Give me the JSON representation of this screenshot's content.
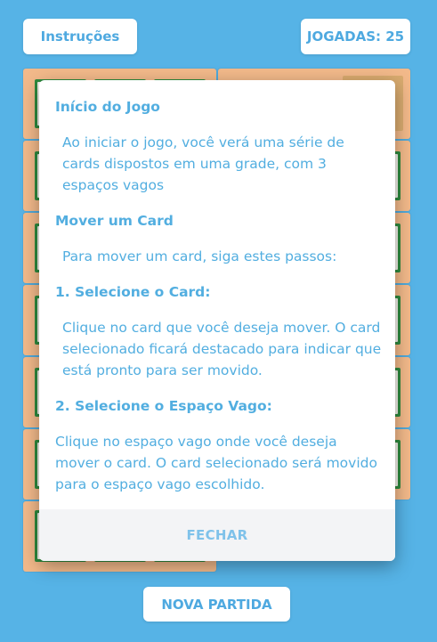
{
  "header": {
    "instructions_label": "Instruções",
    "moves_label": "JOGADAS: 25"
  },
  "modal": {
    "section1_title": "Início do Jogo",
    "section1_text": "Ao iniciar o jogo, você verá uma série de cards dispostos em uma grade, com 3 espaços vagos",
    "section2_title": "Mover um Card",
    "section2_text": "Para mover um card, siga estes passos:",
    "step1_title": "1. Selecione o Card:",
    "step1_text": "Clique no card que você deseja mover. O card selecionado ficará destacado para indicar que está pronto para ser movido.",
    "step2_title": "2. Selecione o Espaço Vago:",
    "step2_text": "Clique no espaço vago onde você deseja mover o card. O card selecionado será movido para o espaço vago escolhido.",
    "close_label": "FECHAR"
  },
  "footer": {
    "new_game_label": "NOVA PARTIDA"
  },
  "colors": {
    "background": "#56b3e6",
    "accent_text": "#52aee0",
    "panel": "#f2b98a",
    "card_green": "#2f8a3e"
  }
}
